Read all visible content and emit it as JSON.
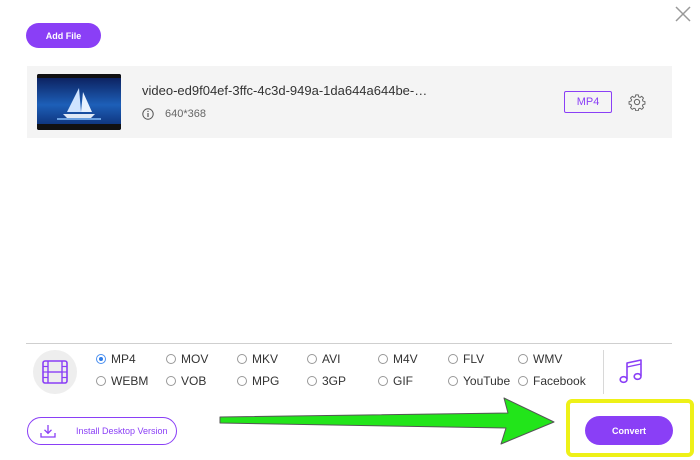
{
  "toolbar": {
    "add_file_label": "Add File"
  },
  "file": {
    "name": "video-ed9f04ef-3ffc-4c3d-949a-1da644a644be-…",
    "resolution": "640*368",
    "output_format": "MP4"
  },
  "formats": {
    "selected": "MP4",
    "options": [
      "MP4",
      "MOV",
      "MKV",
      "AVI",
      "M4V",
      "FLV",
      "WMV",
      "WEBM",
      "VOB",
      "MPG",
      "3GP",
      "GIF",
      "YouTube",
      "Facebook"
    ]
  },
  "footer": {
    "install_label": "Install Desktop Version",
    "convert_label": "Convert"
  },
  "colors": {
    "accent": "#8a3ff6",
    "highlight": "#eef117",
    "arrow": "#22e51a",
    "radio_selected": "#2f7de8"
  },
  "icons": [
    "close-icon",
    "info-icon",
    "gear-icon",
    "video-format-icon",
    "music-icon",
    "download-icon",
    "green-arrow"
  ]
}
